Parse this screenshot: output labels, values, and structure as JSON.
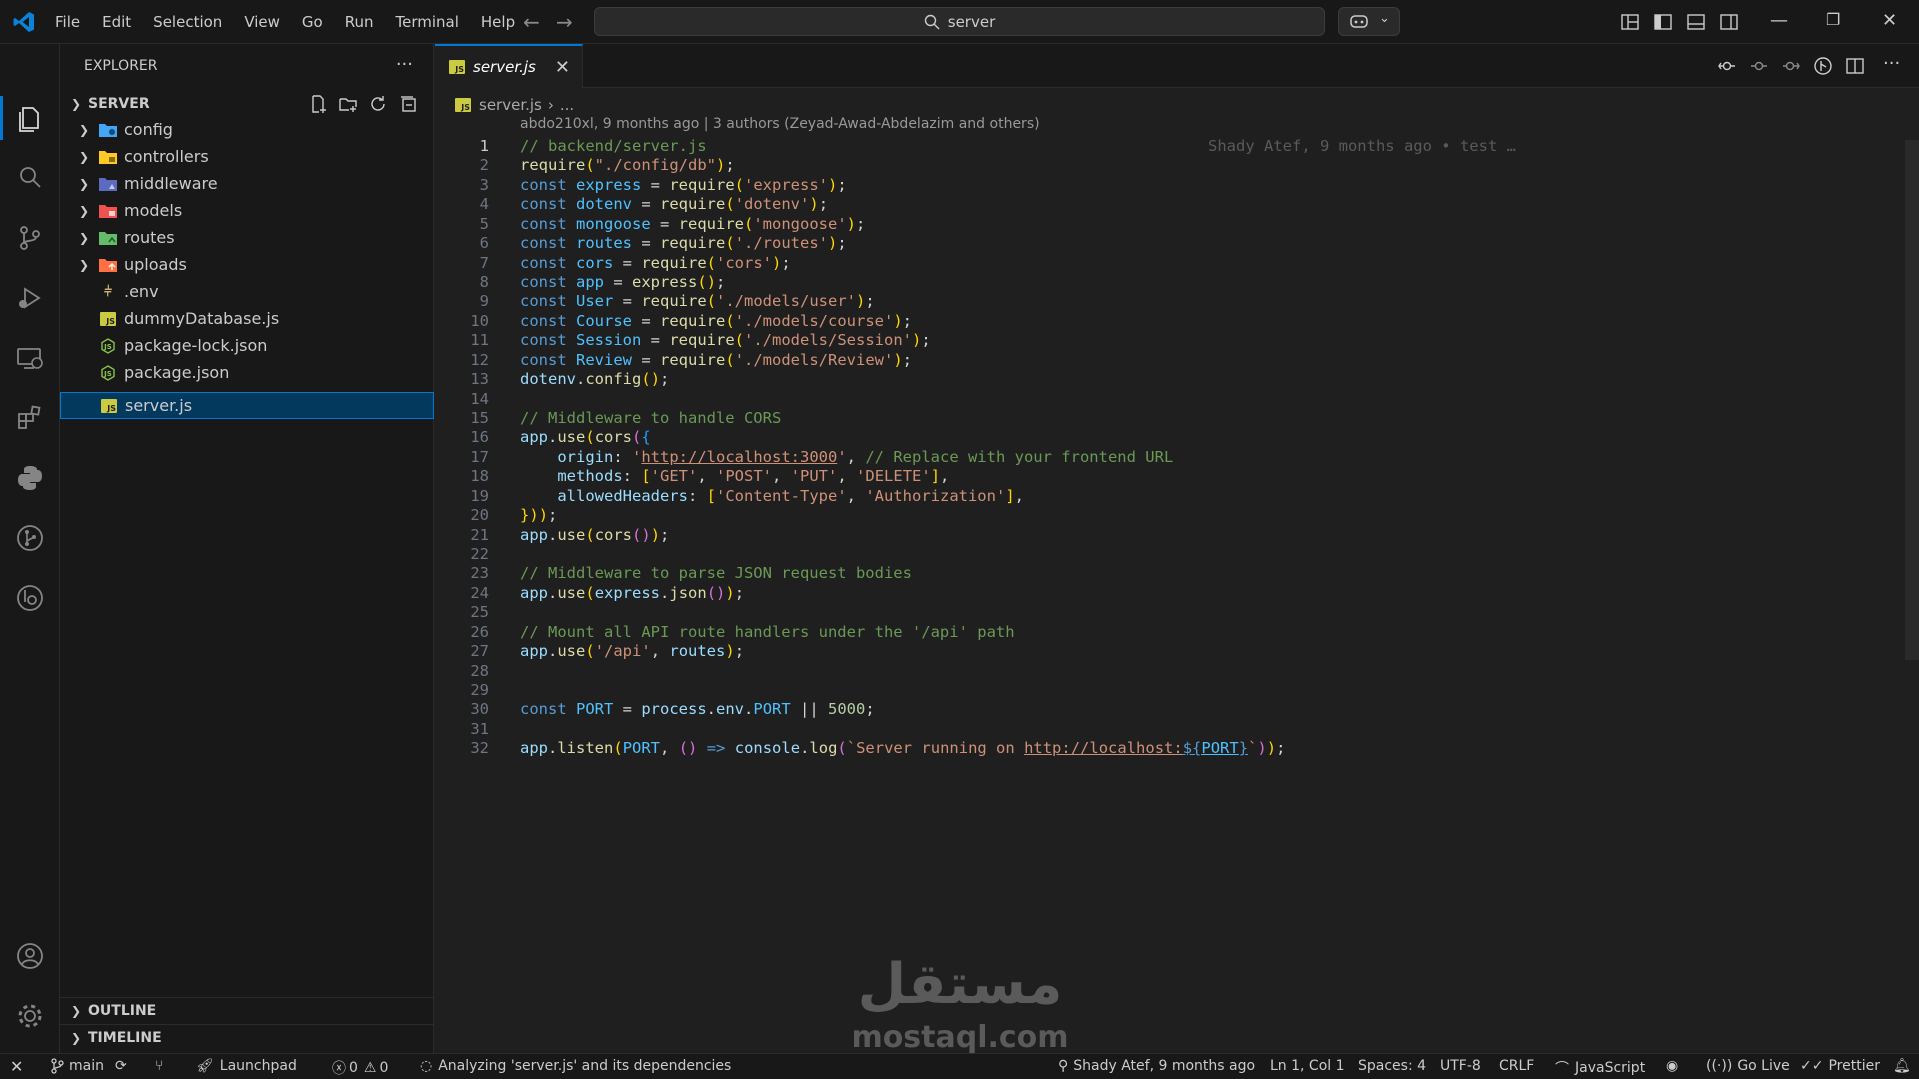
{
  "titlebar": {
    "menu": [
      "File",
      "Edit",
      "Selection",
      "View",
      "Go",
      "Run",
      "Terminal",
      "Help"
    ],
    "search_text": "server"
  },
  "sidebar": {
    "title": "EXPLORER",
    "root": "SERVER",
    "items": [
      {
        "label": "config",
        "type": "folder",
        "icon": "config-folder-icon",
        "color": "#42a5f5"
      },
      {
        "label": "controllers",
        "type": "folder",
        "icon": "controllers-folder-icon",
        "color": "#ffca28"
      },
      {
        "label": "middleware",
        "type": "folder",
        "icon": "middleware-folder-icon",
        "color": "#5c6bc0"
      },
      {
        "label": "models",
        "type": "folder",
        "icon": "models-folder-icon",
        "color": "#ef5350"
      },
      {
        "label": "routes",
        "type": "folder",
        "icon": "routes-folder-icon",
        "color": "#66bb6a"
      },
      {
        "label": "uploads",
        "type": "folder",
        "icon": "uploads-folder-icon",
        "color": "#ff7043"
      },
      {
        "label": ".env",
        "type": "file",
        "icon": "env-file-icon",
        "color": "#e5c07b"
      },
      {
        "label": "dummyDatabase.js",
        "type": "file",
        "icon": "js-file-icon",
        "color": "#cbcb41"
      },
      {
        "label": "package-lock.json",
        "type": "file",
        "icon": "npm-file-icon",
        "color": "#8bc34a"
      },
      {
        "label": "package.json",
        "type": "file",
        "icon": "npm-file-icon",
        "color": "#8bc34a"
      },
      {
        "label": "server.js",
        "type": "file",
        "icon": "js-file-icon",
        "color": "#cbcb41",
        "selected": true
      }
    ],
    "outline": "OUTLINE",
    "timeline": "TIMELINE"
  },
  "editor": {
    "tab_label": "server.js",
    "breadcrumb_file": "server.js",
    "breadcrumb_more": "...",
    "blame_header": "abdo210xl, 9 months ago | 3 authors (Zeyad-Awad-Abdelazim and others)",
    "inline_blame": "Shady Atef, 9 months ago • test …",
    "lines": [
      "// backend/server.js",
      "require(\"./config/db\");",
      "const express = require('express');",
      "const dotenv = require('dotenv');",
      "const mongoose = require('mongoose');",
      "const routes = require('./routes');",
      "const cors = require('cors');",
      "const app = express();",
      "const User = require('./models/user');",
      "const Course = require('./models/course');",
      "const Session = require('./models/Session');",
      "const Review = require('./models/Review');",
      "dotenv.config();",
      "",
      "// Middleware to handle CORS",
      "app.use(cors({",
      "    origin: 'http://localhost:3000', // Replace with your frontend URL",
      "    methods: ['GET', 'POST', 'PUT', 'DELETE'],",
      "    allowedHeaders: ['Content-Type', 'Authorization'],",
      "}));",
      "app.use(cors());",
      "",
      "// Middleware to parse JSON request bodies",
      "app.use(express.json());",
      "",
      "// Mount all API route handlers under the '/api' path",
      "app.use('/api', routes);",
      "",
      "",
      "const PORT = process.env.PORT || 5000;",
      "",
      "app.listen(PORT, () => console.log(`Server running on http://localhost:${PORT}`));"
    ]
  },
  "watermark": {
    "logo_text": "مستقل",
    "text": "mostaql.com"
  },
  "statusbar": {
    "branch": "main",
    "launchpad": "Launchpad",
    "errors": "0",
    "warnings": "0",
    "analyzing": "Analyzing 'server.js' and its dependencies",
    "blame": "Shady Atef, 9 months ago",
    "position": "Ln 1, Col 1",
    "spaces": "Spaces: 4",
    "encoding": "UTF-8",
    "eol": "CRLF",
    "language": "JavaScript",
    "golive": "Go Live",
    "prettier": "Prettier"
  },
  "colors": {
    "accent": "#0078d4",
    "selection": "#04395e"
  }
}
